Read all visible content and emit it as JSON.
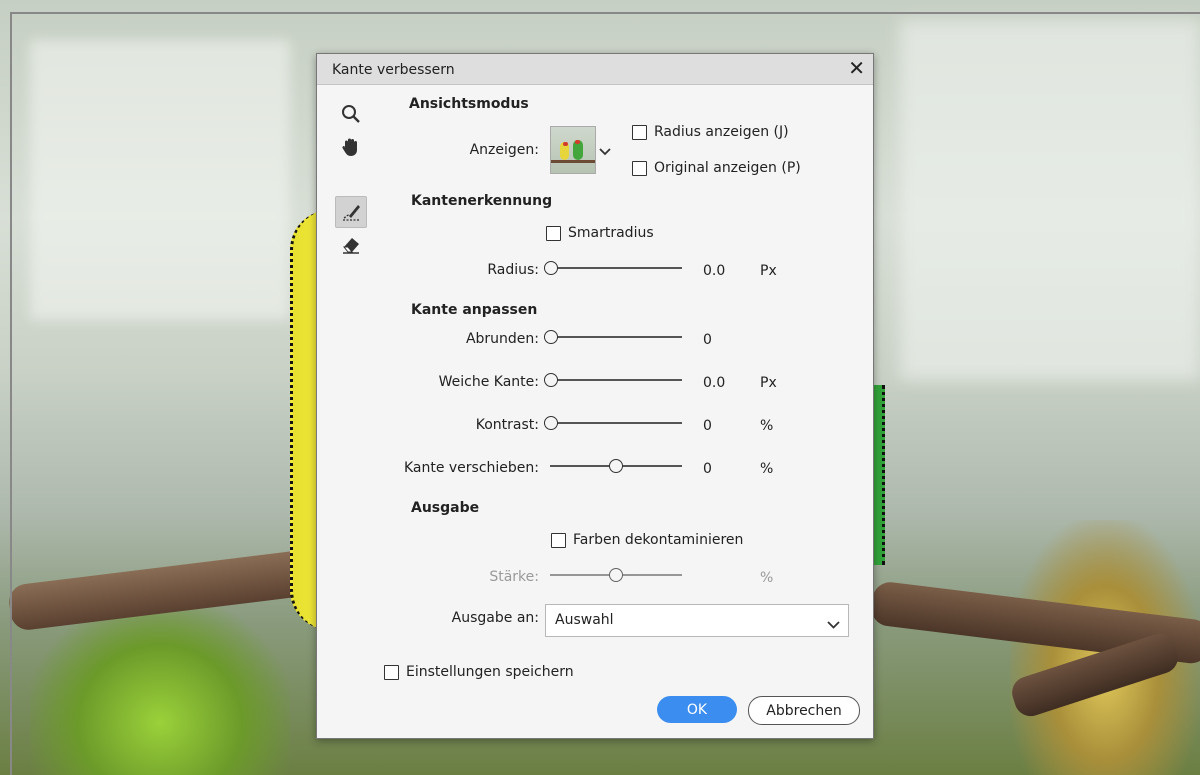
{
  "dialog": {
    "title": "Kante verbessern",
    "close_label": "✕"
  },
  "tools": {
    "zoom": "zoom-icon",
    "hand": "hand-icon",
    "refine": "refine-radius-icon",
    "erase": "erase-refinements-icon"
  },
  "view_mode": {
    "heading": "Ansichtsmodus",
    "show_label": "Anzeigen:",
    "show_radius": "Radius anzeigen (J)",
    "show_original": "Original anzeigen (P)"
  },
  "edge_detection": {
    "heading": "Kantenerkennung",
    "smart_radius": "Smartradius",
    "radius_label": "Radius:",
    "radius_value": "0.0",
    "radius_unit": "Px",
    "radius_level": 0
  },
  "adjust_edge": {
    "heading": "Kante anpassen",
    "smooth_label": "Abrunden:",
    "smooth_value": "0",
    "smooth_level": 0,
    "feather_label": "Weiche Kante:",
    "feather_value": "0.0",
    "feather_unit": "Px",
    "feather_level": 0,
    "contrast_label": "Kontrast:",
    "contrast_value": "0",
    "contrast_unit": "%",
    "contrast_level": 0,
    "shift_label": "Kante verschieben:",
    "shift_value": "0",
    "shift_unit": "%",
    "shift_level": 0.5
  },
  "output": {
    "heading": "Ausgabe",
    "decontaminate": "Farben dekontaminieren",
    "amount_label": "Stärke:",
    "amount_unit": "%",
    "amount_level": 0.5,
    "output_to_label": "Ausgabe an:",
    "output_to_value": "Auswahl"
  },
  "footer": {
    "remember": "Einstellungen speichern",
    "ok": "OK",
    "cancel": "Abbrechen"
  },
  "colors": {
    "accent": "#3b8ef0"
  }
}
